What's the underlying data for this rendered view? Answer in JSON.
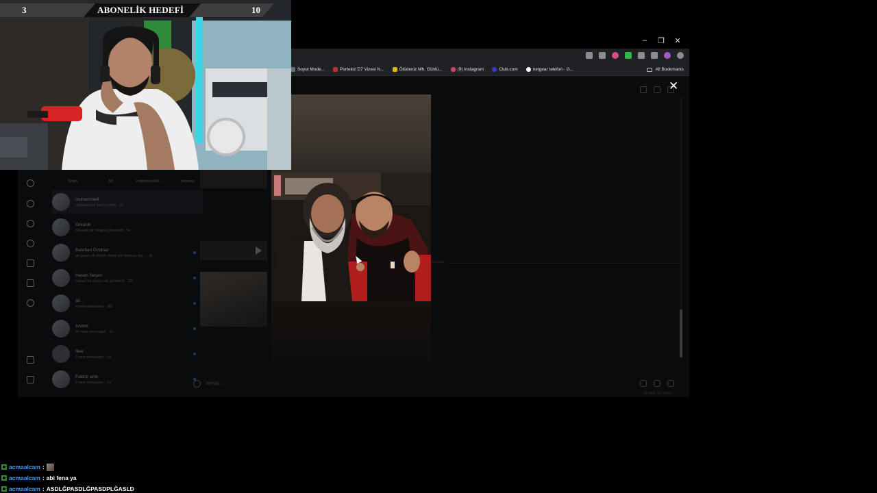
{
  "window_controls": [
    "–",
    "❐",
    "✕"
  ],
  "bookmarks": [
    {
      "label": "Soyut Mode...",
      "color": "#6c6f75"
    },
    {
      "label": "Portekiz D7 Vizesi N...",
      "color": "#b8322e"
    },
    {
      "label": "Ölüdeniz Mh. Günlü...",
      "color": "#e3b400"
    },
    {
      "label": "(9) Instagram",
      "color": "#d6406f"
    },
    {
      "label": "Club.com",
      "color": "#3b3bc9"
    },
    {
      "label": "netgear telefon - G...",
      "color": "#ffffff"
    }
  ],
  "all_bookmarks_label": "All Bookmarks",
  "instagram": {
    "stories": [
      "Selyn",
      "N3",
      "redemkiyuklei...",
      "zehraaa"
    ],
    "conversations": [
      {
        "name": "muhammed",
        "preview": "muhammed sent a video · 5t",
        "dot": false
      },
      {
        "name": "Orkanik",
        "preview": "Orkanik bir fotoğraf gönderdi · 5s",
        "dot": false
      },
      {
        "name": "Batuhan Özdinar",
        "preview": "ah gusm ah insidil olmak siki hotmus dur... · 6t",
        "dot": true
      },
      {
        "name": "Hasan Seçen",
        "preview": "Hasan bir dosya eki gönderdi · 23t",
        "dot": true
      },
      {
        "name": "afi",
        "preview": "4 new messages · 30t",
        "dot": true
      },
      {
        "name": "Ahmet",
        "preview": "4+ new messages · 1s",
        "dot": true
      },
      {
        "name": "İlker",
        "preview": "2 new messages · 1s",
        "dot": true
      },
      {
        "name": "Fakiriz amk",
        "preview": "2 new messages · 1s",
        "dot": true
      }
    ],
    "composer_placeholder": "Mesaj...",
    "seen_label": "Ümitde lei itmet",
    "divider_label": "mesajlar"
  },
  "viewer": {
    "close_label": "✕"
  },
  "overlay": {
    "goal_left": "3",
    "goal_title": "ABONELİK HEDEFİ",
    "goal_right": "10"
  },
  "chat": [
    {
      "user": "acmaalcam",
      "message": "",
      "has_emote": true
    },
    {
      "user": "acmaalcam",
      "message": "abi fena ya",
      "has_emote": false
    },
    {
      "user": "acmaalcam",
      "message": "ASDLĞPASDLĞPASDPLĞASLD",
      "has_emote": false
    }
  ]
}
